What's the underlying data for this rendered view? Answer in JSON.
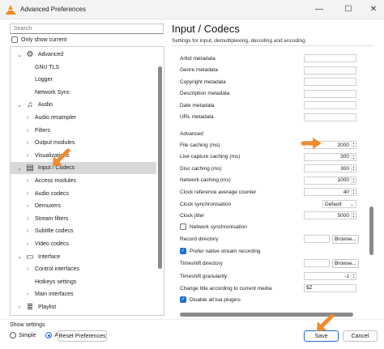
{
  "window": {
    "title": "Advanced Preferences",
    "minimize": "—",
    "maximize": "☐",
    "close": "✕"
  },
  "sidebar": {
    "search_placeholder": "Search",
    "only_show_current": "Only show current",
    "tree": [
      {
        "label": "Advanced",
        "level": 0,
        "expanded": true,
        "icon": "gears-icon"
      },
      {
        "label": "GNU TLS",
        "level": 1
      },
      {
        "label": "Logger",
        "level": 1
      },
      {
        "label": "Network Sync",
        "level": 1
      },
      {
        "label": "Audio",
        "level": 0,
        "expanded": true,
        "icon": "music-note-icon"
      },
      {
        "label": "Audio resampler",
        "level": 1,
        "has_children": true
      },
      {
        "label": "Filters",
        "level": 1,
        "has_children": true
      },
      {
        "label": "Output modules",
        "level": 1,
        "has_children": true
      },
      {
        "label": "Visualizations",
        "level": 1,
        "has_children": true
      },
      {
        "label": "Input / Codecs",
        "level": 0,
        "expanded": true,
        "selected": true,
        "icon": "codec-icon"
      },
      {
        "label": "Access modules",
        "level": 1,
        "has_children": true
      },
      {
        "label": "Audio codecs",
        "level": 1,
        "has_children": true
      },
      {
        "label": "Demuxers",
        "level": 1,
        "has_children": true
      },
      {
        "label": "Stream filters",
        "level": 1,
        "has_children": true
      },
      {
        "label": "Subtitle codecs",
        "level": 1,
        "has_children": true
      },
      {
        "label": "Video codecs",
        "level": 1,
        "has_children": true
      },
      {
        "label": "Interface",
        "level": 0,
        "expanded": true,
        "icon": "interface-icon"
      },
      {
        "label": "Control interfaces",
        "level": 1,
        "has_children": true
      },
      {
        "label": "Hotkeys settings",
        "level": 1
      },
      {
        "label": "Main interfaces",
        "level": 1,
        "has_children": true
      },
      {
        "label": "Playlist",
        "level": 0,
        "has_children": true,
        "icon": "playlist-icon"
      }
    ]
  },
  "footer": {
    "show_settings": "Show settings",
    "simple": "Simple",
    "all": "All",
    "reset": "Reset Preferences",
    "save": "Save",
    "cancel": "Cancel"
  },
  "panel": {
    "title": "Input / Codecs",
    "subtitle": "Settings for input, demultiplexing, decoding and encoding",
    "metadata_rows": [
      {
        "label": "Artist metadata",
        "value": ""
      },
      {
        "label": "Genre metadata",
        "value": ""
      },
      {
        "label": "Copyright metadata",
        "value": ""
      },
      {
        "label": "Description metadata",
        "value": ""
      },
      {
        "label": "Date metadata",
        "value": ""
      },
      {
        "label": "URL metadata",
        "value": ""
      }
    ],
    "advanced_label": "Advanced",
    "spin_rows": [
      {
        "label": "File caching (ms)",
        "value": "2000"
      },
      {
        "label": "Live capture caching (ms)",
        "value": "300"
      },
      {
        "label": "Disc caching (ms)",
        "value": "300"
      },
      {
        "label": "Network caching (ms)",
        "value": "1000"
      },
      {
        "label": "Clock reference average counter",
        "value": "40"
      }
    ],
    "clock_sync": {
      "label": "Clock synchronisation",
      "value": "Default"
    },
    "clock_jitter": {
      "label": "Clock jitter",
      "value": "5000"
    },
    "network_sync": {
      "label": "Network synchronisation",
      "checked": false
    },
    "record_dir": {
      "label": "Record directory",
      "button": "Browse..."
    },
    "prefer_native": {
      "label": "Prefer native stream recording",
      "checked": true
    },
    "timeshift_dir": {
      "label": "Timeshift directory",
      "button": "Browse..."
    },
    "timeshift_gran": {
      "label": "Timeshift granularity",
      "value": "-1"
    },
    "change_title": {
      "label": "Change title according to current media",
      "value": "$Z"
    },
    "disable_lua": {
      "label": "Disable all lua plugins",
      "checked": true
    }
  },
  "colors": {
    "accent": "#1f6cd1",
    "arrow": "#f08a2e",
    "selected_row": "#d8d8d8"
  }
}
